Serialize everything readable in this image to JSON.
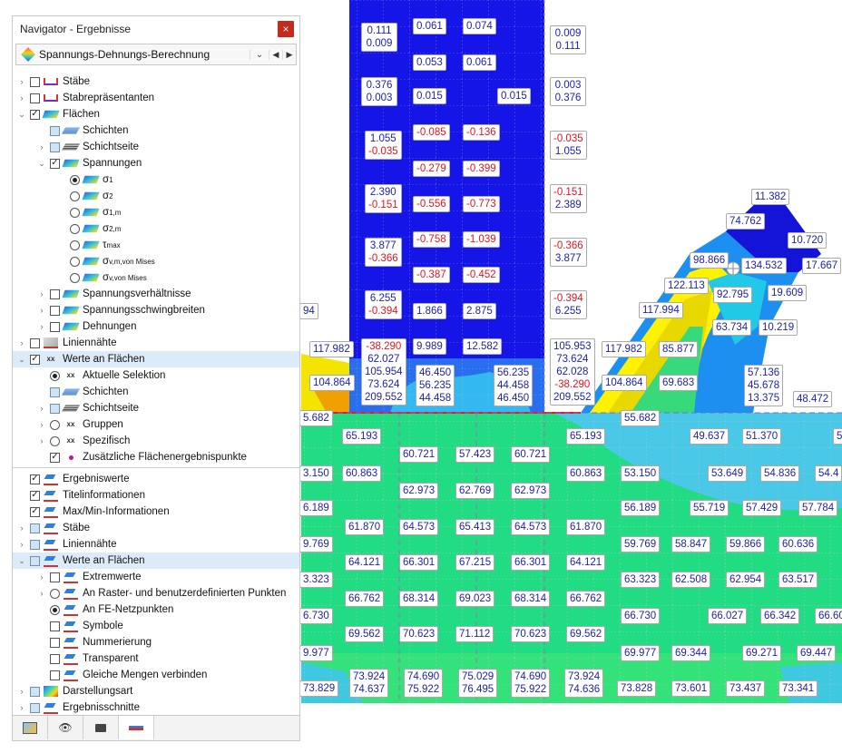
{
  "navigator": {
    "title": "Navigator - Ergebnisse",
    "close_glyph": "×",
    "dropdown": {
      "value": "Spannungs-Dehnungs-Berechnung",
      "arrow": "⌄",
      "prev": "◀",
      "next": "▶"
    },
    "rows": [
      {
        "label": "Stäbe"
      },
      {
        "label": "Stabrepräsentanten"
      },
      {
        "label": "Flächen"
      },
      {
        "label": "Schichten"
      },
      {
        "label": "Schichtseite"
      },
      {
        "label": "Spannungen"
      },
      {
        "label": "σ",
        "sub": "1"
      },
      {
        "label": "σ",
        "sub": "2"
      },
      {
        "label": "σ",
        "sub": "1,m"
      },
      {
        "label": "σ",
        "sub": "2,m"
      },
      {
        "label": "τ",
        "sub": "max"
      },
      {
        "label": "σ",
        "sub": "v,m,von Mises"
      },
      {
        "label": "σ",
        "sub": "v,von Mises"
      },
      {
        "label": "Spannungsverhältnisse"
      },
      {
        "label": "Spannungsschwingbreiten"
      },
      {
        "label": "Dehnungen"
      },
      {
        "label": "Liniennähte"
      },
      {
        "label": "Werte an Flächen"
      },
      {
        "label": "Aktuelle Selektion"
      },
      {
        "label": "Schichten"
      },
      {
        "label": "Schichtseite"
      },
      {
        "label": "Gruppen"
      },
      {
        "label": "Spezifisch"
      },
      {
        "label": "Zusätzliche Flächenergebnispunkte"
      },
      {
        "label": "Ergebniswerte"
      },
      {
        "label": "Titelinformationen"
      },
      {
        "label": "Max/Min-Informationen"
      },
      {
        "label": "Stäbe"
      },
      {
        "label": "Liniennähte"
      },
      {
        "label": "Werte an Flächen"
      },
      {
        "label": "Extremwerte"
      },
      {
        "label": "An Raster- und benutzerdefinierten Punkten"
      },
      {
        "label": "An FE-Netzpunkten"
      },
      {
        "label": "Symbole"
      },
      {
        "label": "Nummerierung"
      },
      {
        "label": "Transparent"
      },
      {
        "label": "Gleiche Mengen verbinden"
      },
      {
        "label": "Darstellungsart"
      },
      {
        "label": "Ergebnisschnitte"
      }
    ],
    "tabs": [
      "data-icon",
      "eye-icon",
      "camera-icon",
      "results-icon"
    ]
  },
  "colors": {
    "accent_selection": "#dcebfa",
    "value_text": "#1e22a8",
    "negative_text": "#e0141e",
    "mesh_blue": "#1a1ae6",
    "mesh_green": "#22dc84"
  },
  "labels": [
    {
      "lines": [
        "0.111",
        "0.009"
      ]
    },
    {
      "lines": [
        "0.061"
      ]
    },
    {
      "lines": [
        "0.074"
      ]
    },
    {
      "lines": [
        "0.009",
        "0.111"
      ]
    },
    {
      "lines": [
        "0.053"
      ]
    },
    {
      "lines": [
        "0.061"
      ]
    },
    {
      "lines": [
        "0.376",
        "0.003"
      ]
    },
    {
      "lines": [
        "0.015"
      ]
    },
    {
      "lines": [
        "0.015"
      ]
    },
    {
      "lines": [
        "0.003",
        "0.376"
      ]
    },
    {
      "lines": [
        "1.055",
        "-0.035"
      ]
    },
    {
      "lines": [
        "-0.085"
      ]
    },
    {
      "lines": [
        "-0.136"
      ]
    },
    {
      "lines": [
        "-0.035",
        "1.055"
      ]
    },
    {
      "lines": [
        "-0.279"
      ]
    },
    {
      "lines": [
        "-0.399"
      ]
    },
    {
      "lines": [
        "2.390",
        "-0.151"
      ]
    },
    {
      "lines": [
        "-0.556"
      ]
    },
    {
      "lines": [
        "-0.773"
      ]
    },
    {
      "lines": [
        "-0.151",
        "2.389"
      ]
    },
    {
      "lines": [
        "3.877",
        "-0.366"
      ]
    },
    {
      "lines": [
        "-0.758"
      ]
    },
    {
      "lines": [
        "-1.039"
      ]
    },
    {
      "lines": [
        "-0.366",
        "3.877"
      ]
    },
    {
      "lines": [
        "-0.387"
      ]
    },
    {
      "lines": [
        "-0.452"
      ]
    },
    {
      "lines": [
        "6.255",
        "-0.394"
      ]
    },
    {
      "lines": [
        "1.866"
      ]
    },
    {
      "lines": [
        "2.875"
      ]
    },
    {
      "lines": [
        "-0.394",
        "6.255"
      ]
    },
    {
      "lines": [
        "94"
      ]
    },
    {
      "lines": [
        "117.982"
      ]
    },
    {
      "lines": [
        "104.864"
      ]
    },
    {
      "lines": [
        "-38.290",
        "62.027",
        "105.954",
        "73.624",
        "209.552"
      ]
    },
    {
      "lines": [
        "9.989"
      ]
    },
    {
      "lines": [
        "12.582"
      ]
    },
    {
      "lines": [
        "46.450",
        "56.235",
        "44.458"
      ]
    },
    {
      "lines": [
        "56.235",
        "44.458",
        "46.450"
      ]
    },
    {
      "lines": [
        "105.953",
        "73.624",
        "62.028",
        "-38.290",
        "209.552"
      ]
    },
    {
      "lines": [
        "117.982"
      ]
    },
    {
      "lines": [
        "104.864"
      ]
    },
    {
      "lines": [
        "85.877"
      ]
    },
    {
      "lines": [
        "69.683"
      ]
    },
    {
      "lines": [
        "117.994"
      ]
    },
    {
      "lines": [
        "122.113"
      ]
    },
    {
      "lines": [
        "98.866"
      ]
    },
    {
      "lines": [
        "134.532"
      ]
    },
    {
      "lines": [
        "92.795"
      ]
    },
    {
      "lines": [
        "74.762"
      ]
    },
    {
      "lines": [
        "11.382"
      ]
    },
    {
      "lines": [
        "10.720"
      ]
    },
    {
      "lines": [
        "17.667"
      ]
    },
    {
      "lines": [
        "19.609"
      ]
    },
    {
      "lines": [
        "63.734"
      ]
    },
    {
      "lines": [
        "10.219"
      ]
    },
    {
      "lines": [
        "57.136",
        "45.678",
        "13.375"
      ]
    },
    {
      "lines": [
        "48.472"
      ]
    },
    {
      "lines": [
        "5.682"
      ]
    },
    {
      "lines": [
        "55.682"
      ]
    },
    {
      "lines": [
        "65.193"
      ]
    },
    {
      "lines": [
        "65.193"
      ]
    },
    {
      "lines": [
        "49.637"
      ]
    },
    {
      "lines": [
        "51.370"
      ]
    },
    {
      "lines": [
        "5"
      ]
    },
    {
      "lines": [
        "60.721"
      ]
    },
    {
      "lines": [
        "57.423"
      ]
    },
    {
      "lines": [
        "60.721"
      ]
    },
    {
      "lines": [
        "3.150"
      ]
    },
    {
      "lines": [
        "60.863"
      ]
    },
    {
      "lines": [
        "60.863"
      ]
    },
    {
      "lines": [
        "53.150"
      ]
    },
    {
      "lines": [
        "53.649"
      ]
    },
    {
      "lines": [
        "54.836"
      ]
    },
    {
      "lines": [
        "54.4"
      ]
    },
    {
      "lines": [
        "62.973"
      ]
    },
    {
      "lines": [
        "62.769"
      ]
    },
    {
      "lines": [
        "62.973"
      ]
    },
    {
      "lines": [
        "6.189"
      ]
    },
    {
      "lines": [
        "56.189"
      ]
    },
    {
      "lines": [
        "55.719"
      ]
    },
    {
      "lines": [
        "57.429"
      ]
    },
    {
      "lines": [
        "57.784"
      ]
    },
    {
      "lines": [
        "61.870"
      ]
    },
    {
      "lines": [
        "64.573"
      ]
    },
    {
      "lines": [
        "65.413"
      ]
    },
    {
      "lines": [
        "64.573"
      ]
    },
    {
      "lines": [
        "61.870"
      ]
    },
    {
      "lines": [
        "9.769"
      ]
    },
    {
      "lines": [
        "59.769"
      ]
    },
    {
      "lines": [
        "58.847"
      ]
    },
    {
      "lines": [
        "59.866"
      ]
    },
    {
      "lines": [
        "60.636"
      ]
    },
    {
      "lines": [
        "64.121"
      ]
    },
    {
      "lines": [
        "66.301"
      ]
    },
    {
      "lines": [
        "67.215"
      ]
    },
    {
      "lines": [
        "66.301"
      ]
    },
    {
      "lines": [
        "64.121"
      ]
    },
    {
      "lines": [
        "3.323"
      ]
    },
    {
      "lines": [
        "63.323"
      ]
    },
    {
      "lines": [
        "62.508"
      ]
    },
    {
      "lines": [
        "62.954"
      ]
    },
    {
      "lines": [
        "63.517"
      ]
    },
    {
      "lines": [
        "66.762"
      ]
    },
    {
      "lines": [
        "68.314"
      ]
    },
    {
      "lines": [
        "69.023"
      ]
    },
    {
      "lines": [
        "68.314"
      ]
    },
    {
      "lines": [
        "66.762"
      ]
    },
    {
      "lines": [
        "6.730"
      ]
    },
    {
      "lines": [
        "66.730"
      ]
    },
    {
      "lines": [
        "66.027"
      ]
    },
    {
      "lines": [
        "66.342"
      ]
    },
    {
      "lines": [
        "66.60"
      ]
    },
    {
      "lines": [
        "69.562"
      ]
    },
    {
      "lines": [
        "70.623"
      ]
    },
    {
      "lines": [
        "71.112"
      ]
    },
    {
      "lines": [
        "70.623"
      ]
    },
    {
      "lines": [
        "69.562"
      ]
    },
    {
      "lines": [
        "9.977"
      ]
    },
    {
      "lines": [
        "69.977"
      ]
    },
    {
      "lines": [
        "69.344"
      ]
    },
    {
      "lines": [
        "69.271"
      ]
    },
    {
      "lines": [
        "69.447"
      ]
    },
    {
      "lines": [
        "73.924",
        "74.637"
      ]
    },
    {
      "lines": [
        "74.690",
        "75.922"
      ]
    },
    {
      "lines": [
        "75.029",
        "76.495"
      ]
    },
    {
      "lines": [
        "74.690",
        "75.922"
      ]
    },
    {
      "lines": [
        "73.924",
        "74.636"
      ]
    },
    {
      "lines": [
        "73.829"
      ]
    },
    {
      "lines": [
        "73.828"
      ]
    },
    {
      "lines": [
        "73.601"
      ]
    },
    {
      "lines": [
        "73.437"
      ]
    },
    {
      "lines": [
        "73.341"
      ]
    }
  ]
}
